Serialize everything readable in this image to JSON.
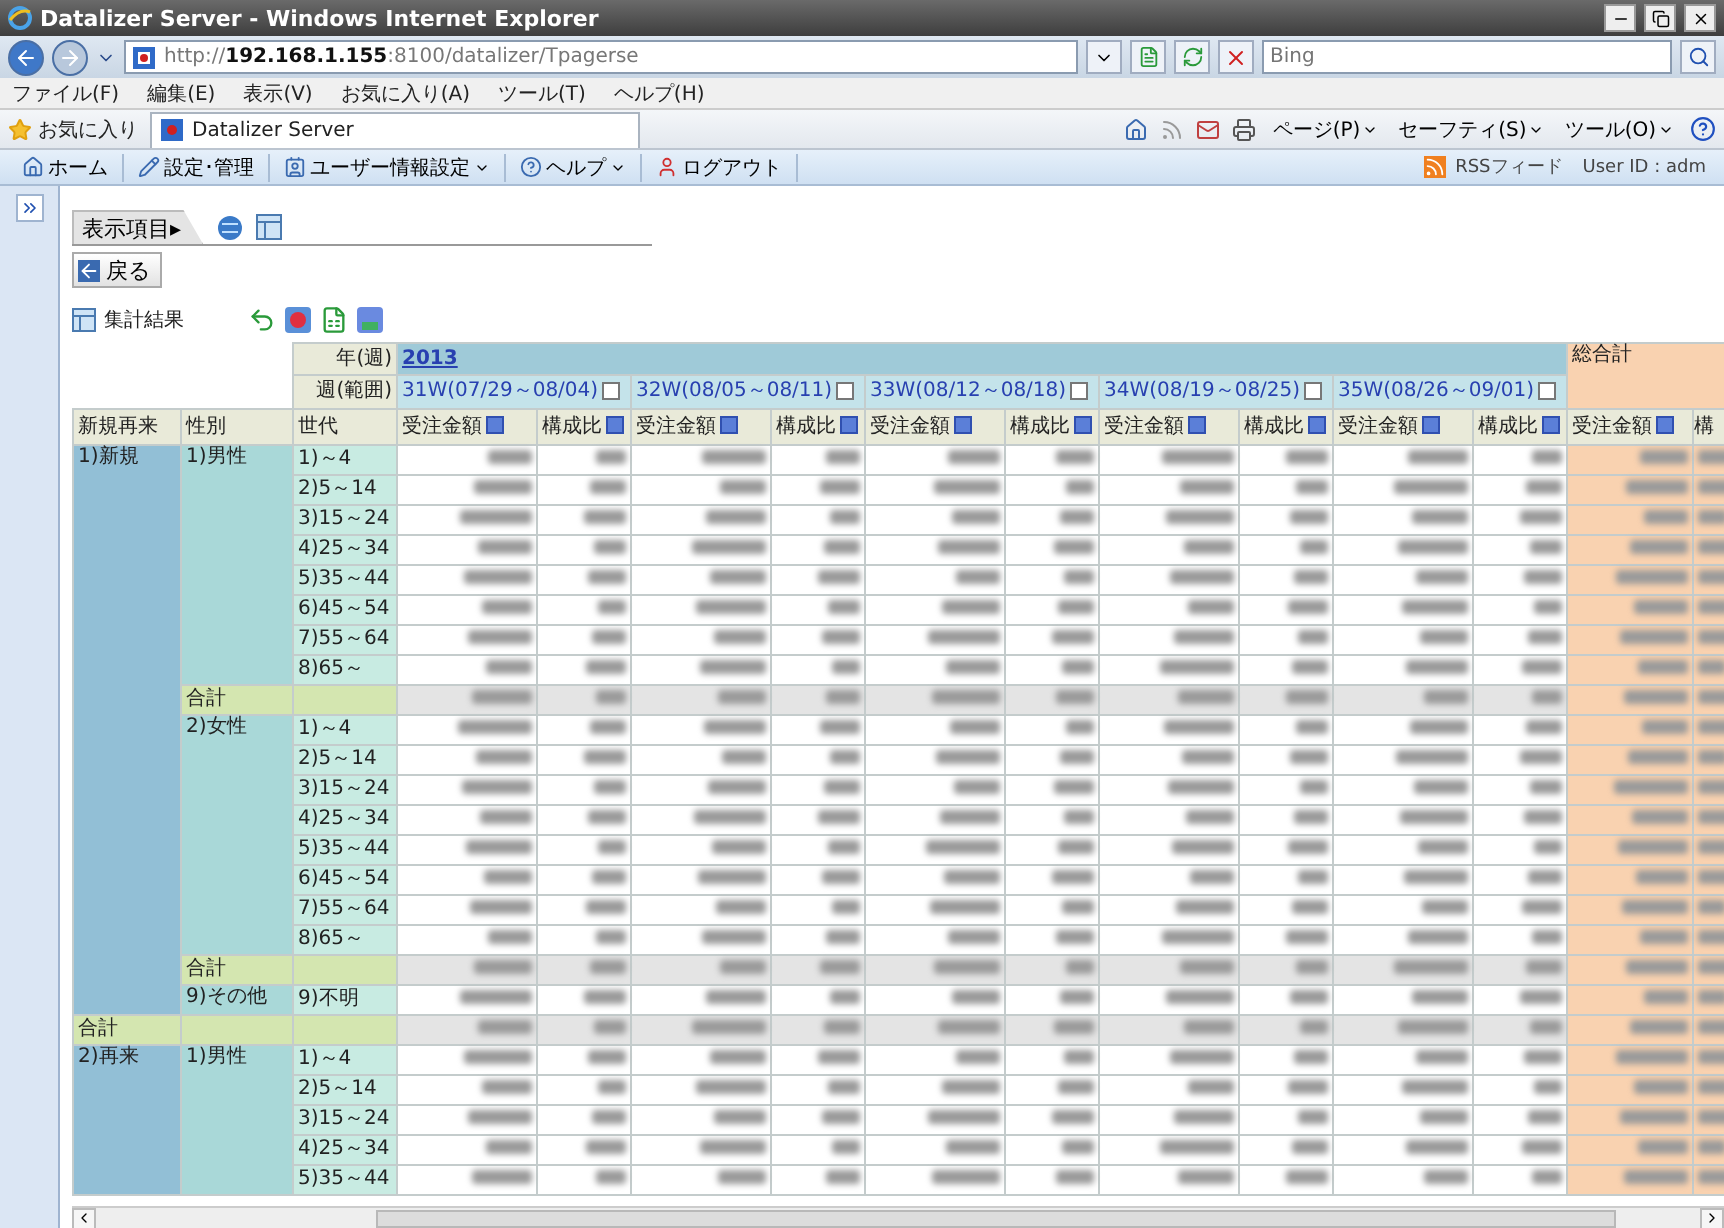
{
  "window": {
    "title": "Datalizer Server - Windows Internet Explorer"
  },
  "address_bar": {
    "url": "http://**192.168.1.155**:8100/datalizer/Tpagerse",
    "search_placeholder": "Bing"
  },
  "menu_bar": [
    "ファイル(F)",
    "編集(E)",
    "表示(V)",
    "お気に入り(A)",
    "ツール(T)",
    "ヘルプ(H)"
  ],
  "favorites_bar": {
    "favorites": "お気に入り",
    "tab": "Datalizer Server",
    "commands": [
      "ページ(P)",
      "セーフティ(S)",
      "ツール(O)"
    ]
  },
  "app_toolbar": {
    "items": [
      {
        "label": "ホーム",
        "dropdown": false
      },
      {
        "label": "設定･管理",
        "dropdown": false
      },
      {
        "label": "ユーザー情報設定",
        "dropdown": true
      },
      {
        "label": "ヘルプ",
        "dropdown": true
      },
      {
        "label": "ログアウト",
        "dropdown": false
      }
    ],
    "rss": "RSSフィード",
    "user": "User ID : adm"
  },
  "panel": {
    "tab": "表示項目▸",
    "back": "戻る",
    "title": "集計結果"
  },
  "table": {
    "corner_labels": [
      "年(週)",
      "週(範囲)"
    ],
    "year": "2013",
    "weeks": [
      {
        "label": "31W(07/29～08/04)",
        "measures": [
          "受注金額",
          "構成比"
        ]
      },
      {
        "label": "32W(08/05～08/11)",
        "measures": [
          "受注金額",
          "構成比"
        ]
      },
      {
        "label": "33W(08/12～08/18)",
        "measures": [
          "受注金額",
          "構成比"
        ]
      },
      {
        "label": "34W(08/19～08/25)",
        "measures": [
          "受注金額",
          "構成比"
        ]
      },
      {
        "label": "35W(08/26～09/01)",
        "measures": [
          "受注金額",
          "構成比"
        ]
      }
    ],
    "grand_total": "総合計",
    "row_headers": [
      "新規再来",
      "性別",
      "世代"
    ],
    "grand_total_measures": [
      "受注金額",
      "構"
    ],
    "rows": [
      {
        "label": "1)新規",
        "children": [
          {
            "label": "1)男性",
            "children": [
              {
                "label": "1)～4"
              },
              {
                "label": "2)5～14"
              },
              {
                "label": "3)15～24"
              },
              {
                "label": "4)25～34"
              },
              {
                "label": "5)35～44"
              },
              {
                "label": "6)45～54"
              },
              {
                "label": "7)55～64"
              },
              {
                "label": "8)65～"
              }
            ]
          },
          {
            "label": "合計"
          },
          {
            "label": "2)女性",
            "children": [
              {
                "label": "1)～4"
              },
              {
                "label": "2)5～14"
              },
              {
                "label": "3)15～24"
              },
              {
                "label": "4)25～34"
              },
              {
                "label": "5)35～44"
              },
              {
                "label": "6)45～54"
              },
              {
                "label": "7)55～64"
              },
              {
                "label": "8)65～"
              }
            ]
          },
          {
            "label": "合計"
          },
          {
            "label": "9)その他",
            "children": [
              {
                "label": "9)不明"
              }
            ]
          }
        ]
      },
      {
        "label": "合計"
      },
      {
        "label": "2)再来",
        "children": [
          {
            "label": "1)男性",
            "children": [
              {
                "label": "1)～4"
              },
              {
                "label": "2)5～14"
              },
              {
                "label": "3)15～24"
              },
              {
                "label": "4)25～34"
              },
              {
                "label": "5)35～44"
              }
            ]
          }
        ]
      }
    ]
  }
}
